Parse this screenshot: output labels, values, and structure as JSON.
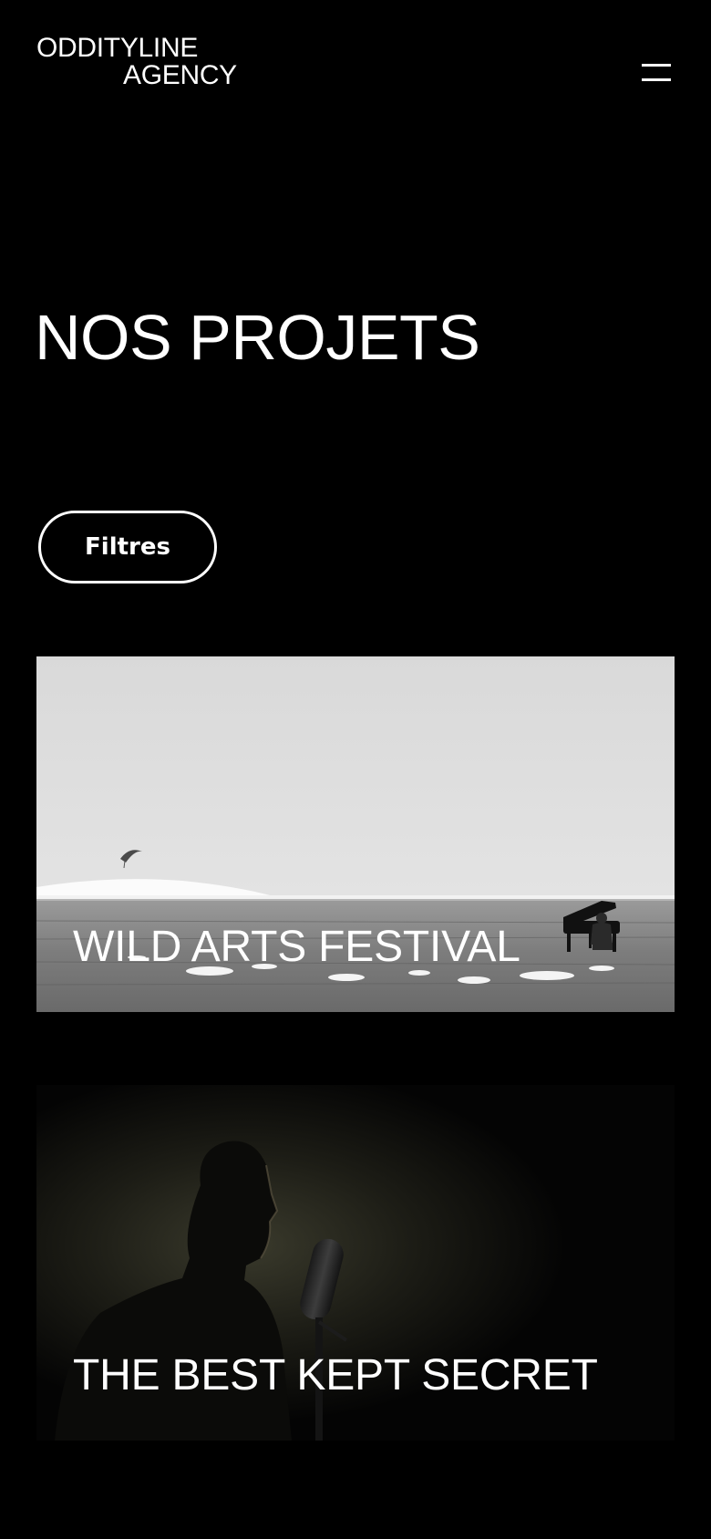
{
  "header": {
    "logo_line1": "ODDITYLINE",
    "logo_line2": "AGENCY",
    "menu_icon": "hamburger-menu-icon"
  },
  "main": {
    "title": "NOS PROJETS",
    "filters_label": "Filtres",
    "projects": [
      {
        "title": "WILD ARTS FESTIVAL",
        "image": "pianist-on-grassland-photo"
      },
      {
        "title": "THE BEST KEPT SECRET",
        "image": "singer-with-microphone-photo"
      }
    ]
  },
  "colors": {
    "background": "#000000",
    "text": "#ffffff"
  }
}
